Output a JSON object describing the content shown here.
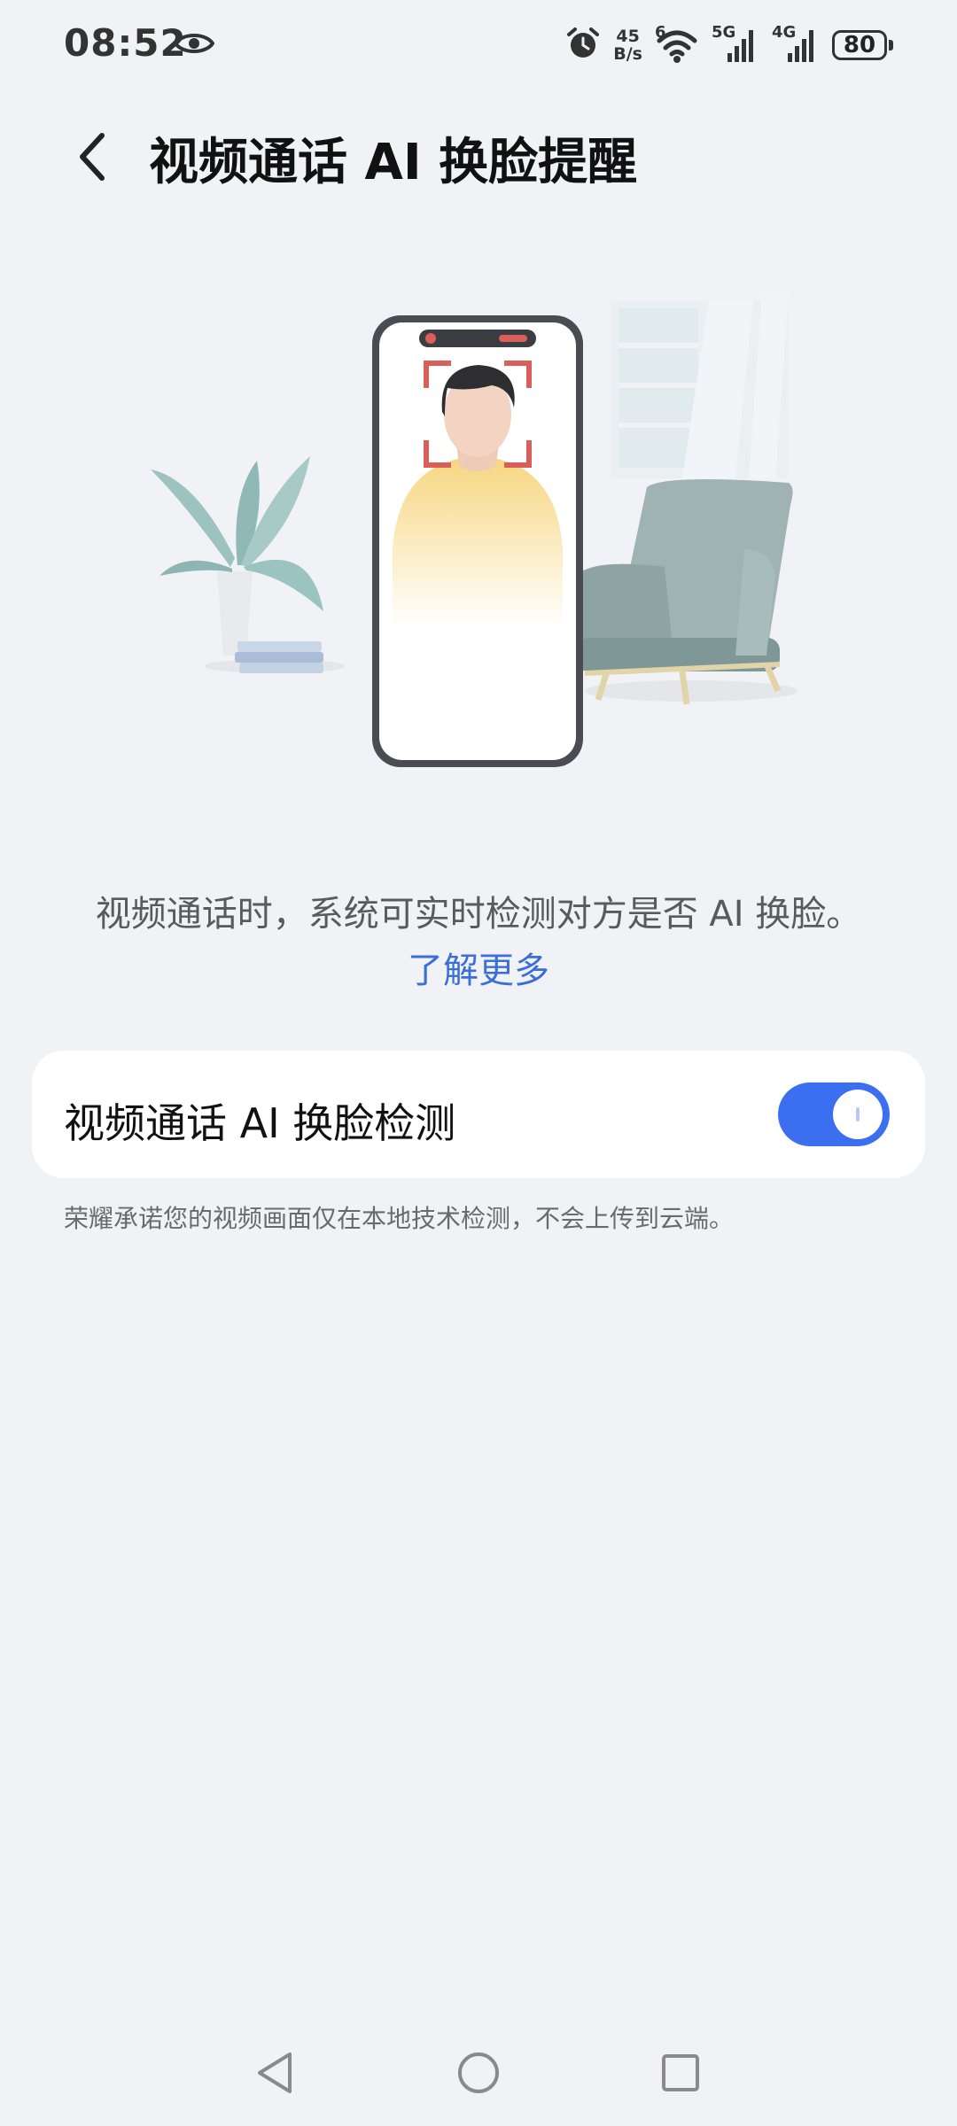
{
  "status_bar": {
    "time": "08:52",
    "net_speed_value": "45",
    "net_speed_unit": "B/s",
    "wifi_badge": "6",
    "signal1_label": "5G",
    "signal2_label": "4G",
    "battery_level": "80"
  },
  "header": {
    "title": "视频通话 AI 换脸提醒"
  },
  "main": {
    "description": "视频通话时，系统可实时检测对方是否 AI 换脸。",
    "learn_more": "了解更多",
    "setting_label": "视频通话 AI 换脸检测",
    "setting_enabled": true,
    "note": "荣耀承诺您的视频画面仅在本地技术检测，不会上传到云端。"
  },
  "colors": {
    "accent": "#3b6ff0",
    "link": "#3a6fd8",
    "background": "#f1f2f6"
  },
  "icons": {
    "eye": "eye-icon",
    "alarm": "alarm-icon",
    "wifi": "wifi-icon",
    "back": "back-arrow-icon",
    "nav_back": "nav-back-icon",
    "nav_home": "nav-home-icon",
    "nav_recents": "nav-recents-icon"
  }
}
